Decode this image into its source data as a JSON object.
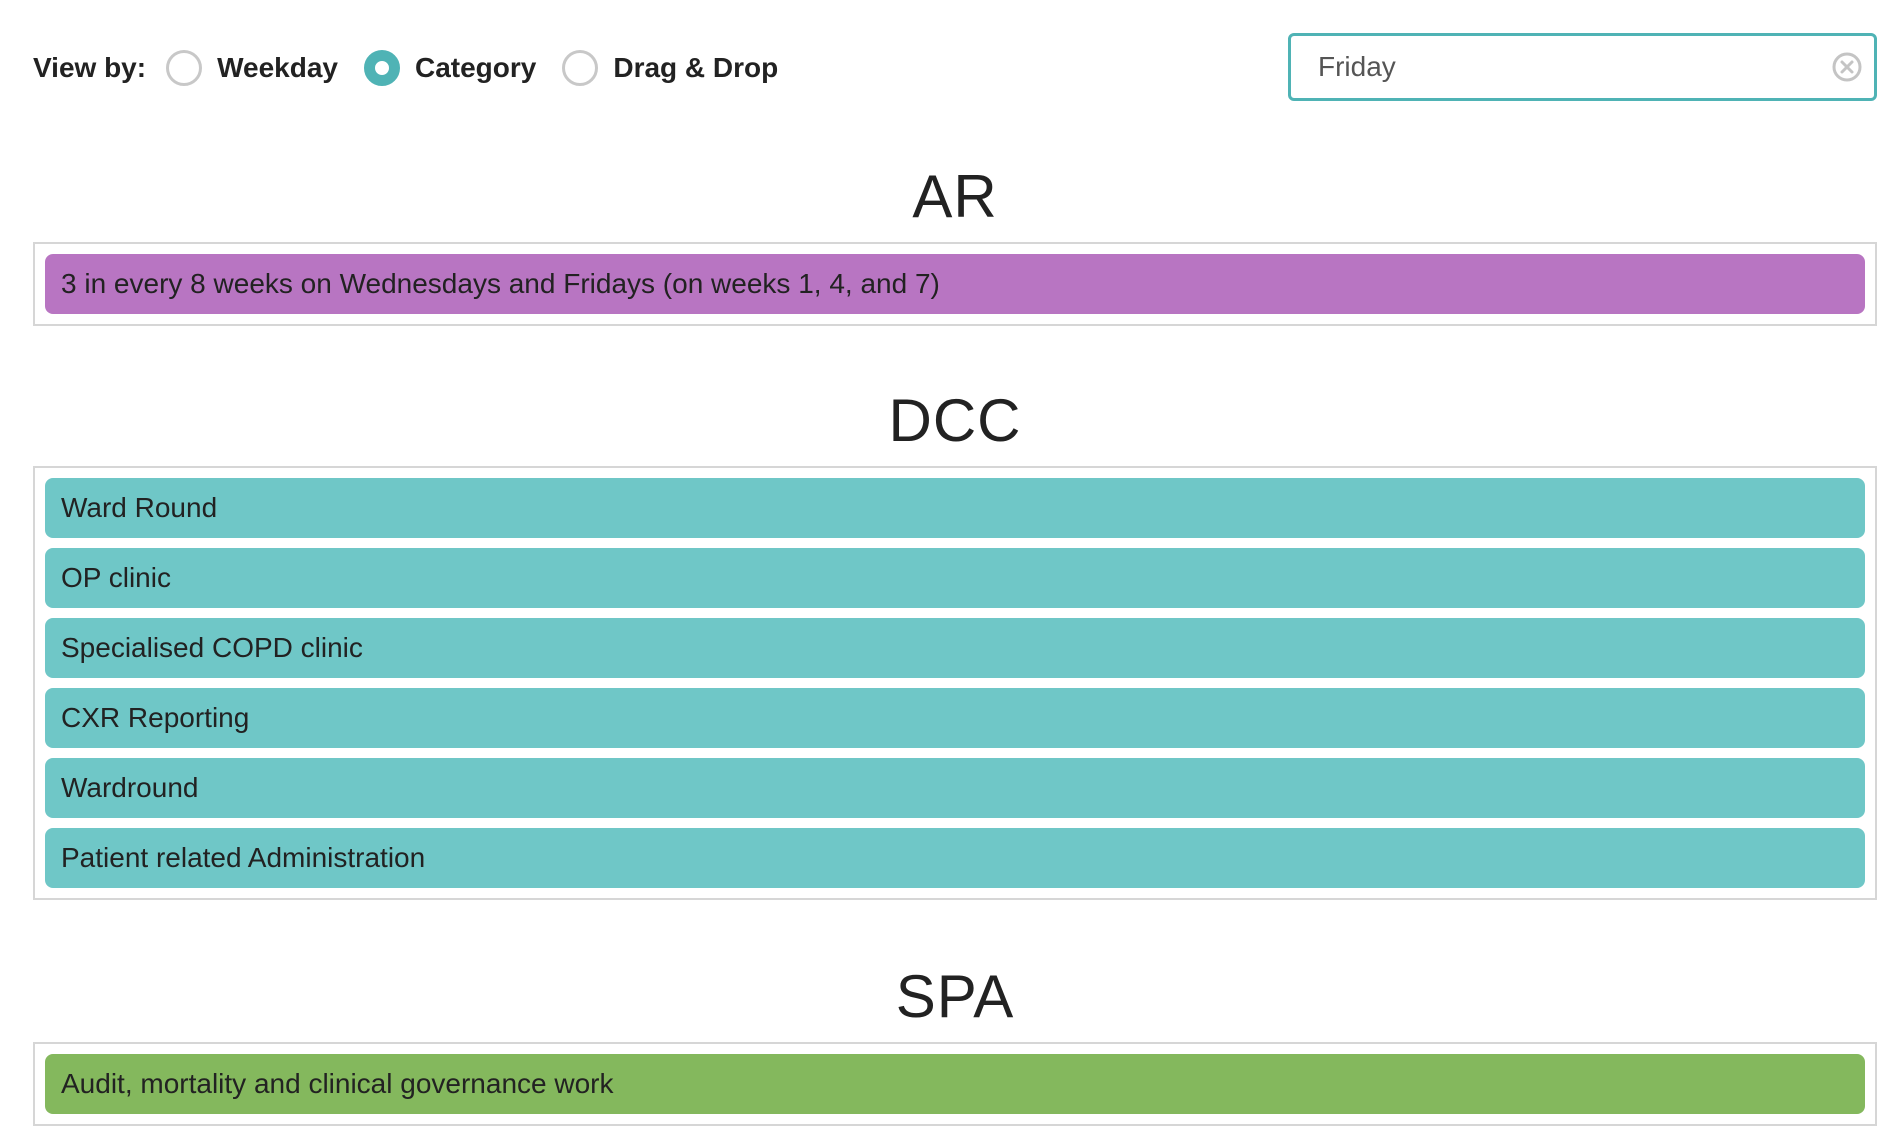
{
  "toolbar": {
    "view_by_label": "View by:",
    "options": [
      {
        "label": "Weekday",
        "checked": false
      },
      {
        "label": "Category",
        "checked": true
      },
      {
        "label": "Drag & Drop",
        "checked": false
      }
    ]
  },
  "search": {
    "value": "Friday",
    "clear_icon": "clear-circle-icon"
  },
  "colors": {
    "accent": "#4fb3b5",
    "ar": "#b875c2",
    "dcc": "#6fc7c7",
    "spa": "#84b85d"
  },
  "sections": [
    {
      "title": "AR",
      "items": [
        "3 in every 8 weeks on Wednesdays and Fridays (on weeks 1, 4, and 7)"
      ]
    },
    {
      "title": "DCC",
      "items": [
        "Ward Round",
        "OP clinic",
        "Specialised COPD clinic",
        "CXR Reporting",
        "Wardround",
        "Patient related Administration"
      ]
    },
    {
      "title": "SPA",
      "items": [
        "Audit, mortality and clinical governance work"
      ]
    }
  ]
}
